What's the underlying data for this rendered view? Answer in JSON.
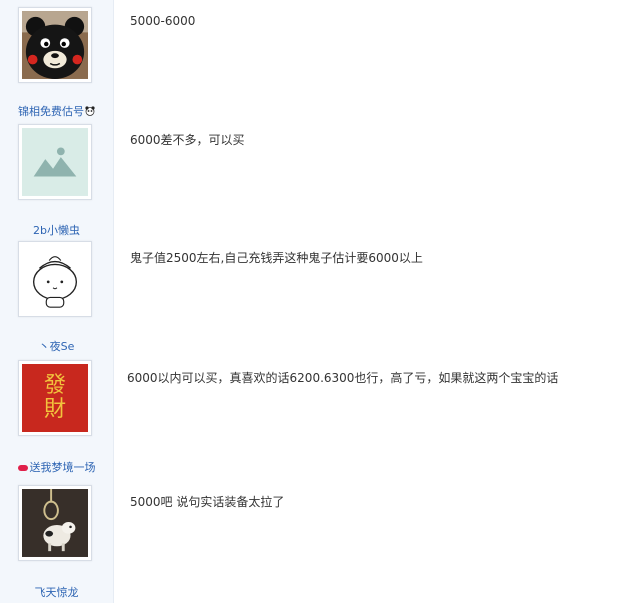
{
  "posts": [
    {
      "username": "",
      "content": "5000-6000",
      "avatar_icon": "kumamon-avatar"
    },
    {
      "username": "锦相免费估号",
      "content": "6000差不多，可以买",
      "avatar_icon": "default-mountain-avatar"
    },
    {
      "username": "2b小懒虫",
      "content": "鬼子值2500左右,自己充钱弄这种鬼子估计要6000以上",
      "avatar_icon": "cartoon-figure-avatar"
    },
    {
      "username": "丶夜Se",
      "content": "6000以内可以买，真喜欢的话6200.6300也行，高了亏，如果就这两个宝宝的话",
      "avatar_icon": "facai-character-avatar"
    },
    {
      "username": "送我梦境一场",
      "content": "5000吧 说句实话装备太拉了",
      "avatar_icon": "noose-sheep-avatar"
    },
    {
      "username": "飞天惊龙",
      "content": "",
      "avatar_icon": ""
    }
  ],
  "avatar_text": {
    "facai_top": "發",
    "facai_bottom": "財"
  },
  "colors": {
    "username": "#2d64b3",
    "sidebar_bg": "#f3f7fc",
    "facai_bg": "#c8281e",
    "facai_text": "#f2c33d"
  }
}
